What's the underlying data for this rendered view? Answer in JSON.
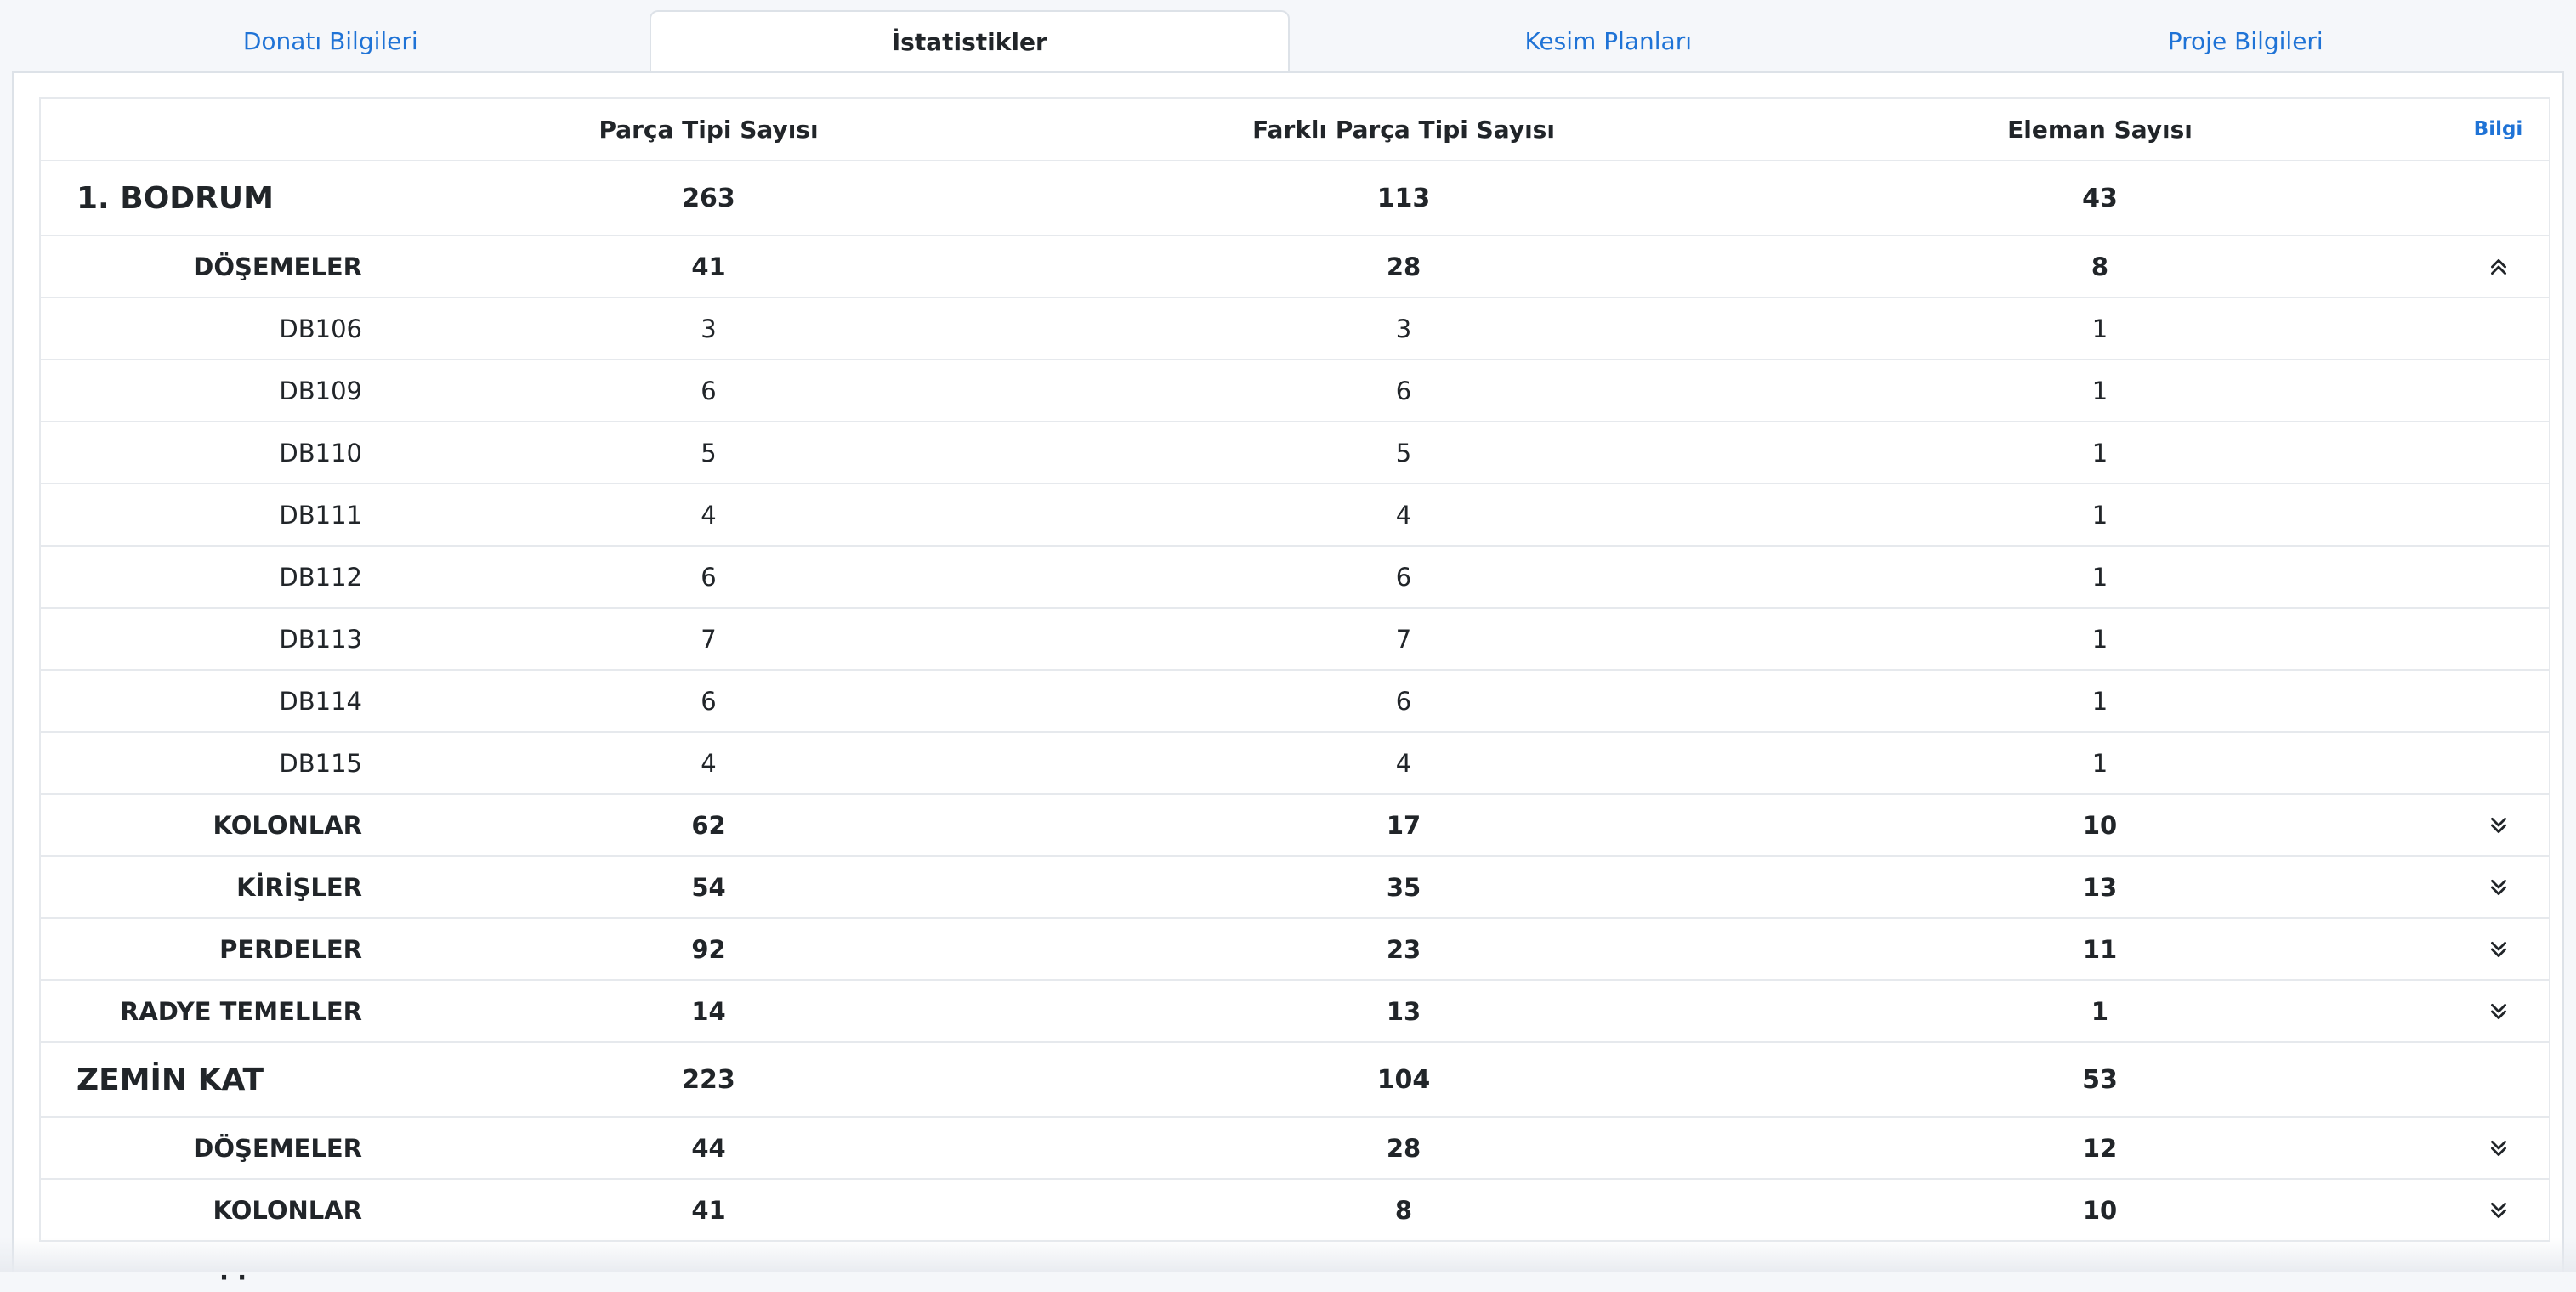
{
  "tabs": [
    {
      "label": "Donatı Bilgileri"
    },
    {
      "label": "İstatistikler"
    },
    {
      "label": "Kesim Planları"
    },
    {
      "label": "Proje Bilgileri"
    }
  ],
  "table": {
    "headers": {
      "col1": "Parça Tipi Sayısı",
      "col2": "Farklı Parça Tipi Sayısı",
      "col3": "Eleman Sayısı",
      "info": "Bilgi"
    },
    "rows": [
      {
        "kind": "group",
        "name": "1. BODRUM",
        "parca": "263",
        "farkli": "113",
        "eleman": "43"
      },
      {
        "kind": "cat",
        "name": "DÖŞEMELER",
        "parca": "41",
        "farkli": "28",
        "eleman": "8",
        "toggle": "chevron-double-up-icon"
      },
      {
        "kind": "item",
        "name": "DB106",
        "parca": "3",
        "farkli": "3",
        "eleman": "1"
      },
      {
        "kind": "item",
        "name": "DB109",
        "parca": "6",
        "farkli": "6",
        "eleman": "1"
      },
      {
        "kind": "item",
        "name": "DB110",
        "parca": "5",
        "farkli": "5",
        "eleman": "1"
      },
      {
        "kind": "item",
        "name": "DB111",
        "parca": "4",
        "farkli": "4",
        "eleman": "1"
      },
      {
        "kind": "item",
        "name": "DB112",
        "parca": "6",
        "farkli": "6",
        "eleman": "1"
      },
      {
        "kind": "item",
        "name": "DB113",
        "parca": "7",
        "farkli": "7",
        "eleman": "1"
      },
      {
        "kind": "item",
        "name": "DB114",
        "parca": "6",
        "farkli": "6",
        "eleman": "1"
      },
      {
        "kind": "item",
        "name": "DB115",
        "parca": "4",
        "farkli": "4",
        "eleman": "1"
      },
      {
        "kind": "cat",
        "name": "KOLONLAR",
        "parca": "62",
        "farkli": "17",
        "eleman": "10",
        "toggle": "chevron-double-down-icon"
      },
      {
        "kind": "cat",
        "name": "KİRİŞLER",
        "parca": "54",
        "farkli": "35",
        "eleman": "13",
        "toggle": "chevron-double-down-icon"
      },
      {
        "kind": "cat",
        "name": "PERDELER",
        "parca": "92",
        "farkli": "23",
        "eleman": "11",
        "toggle": "chevron-double-down-icon"
      },
      {
        "kind": "cat",
        "name": "RADYE TEMELLER",
        "parca": "14",
        "farkli": "13",
        "eleman": "1",
        "toggle": "chevron-double-down-icon"
      },
      {
        "kind": "group",
        "name": "ZEMİN KAT",
        "parca": "223",
        "farkli": "104",
        "eleman": "53"
      },
      {
        "kind": "cat",
        "name": "DÖŞEMELER",
        "parca": "44",
        "farkli": "28",
        "eleman": "12",
        "toggle": "chevron-double-down-icon"
      },
      {
        "kind": "cat",
        "name": "KOLONLAR",
        "parca": "41",
        "farkli": "8",
        "eleman": "10",
        "toggle": "chevron-double-down-icon"
      }
    ]
  },
  "colors": {
    "accent": "#1f73d6",
    "border": "#e6e9ed",
    "text": "#212529"
  }
}
